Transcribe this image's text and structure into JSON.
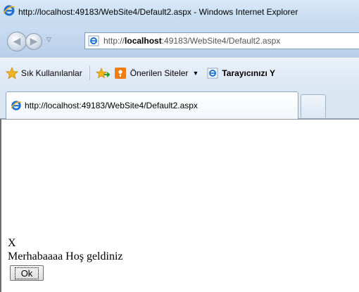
{
  "window": {
    "title": "http://localhost:49183/WebSite4/Default2.aspx - Windows Internet Explorer"
  },
  "navigation": {
    "address_prefix": "http://",
    "address_host": "localhost",
    "address_rest": ":49183/WebSite4/Default2.aspx"
  },
  "favorites_bar": {
    "favorites_label": "Sık Kullanılanlar",
    "suggested_sites_label": "Önerilen Siteler",
    "browser_label": "Tarayıcınızı Y"
  },
  "tabs": [
    {
      "label": "http://localhost:49183/WebSite4/Default2.aspx"
    }
  ],
  "page": {
    "close_text": "X",
    "welcome_text": "Merhabaaaa Hoş geldiniz",
    "ok_label": "Ok"
  },
  "colors": {
    "ie_blue": "#1e6fd0",
    "favorites_star": "#f2b31b",
    "suggested_sites_orange": "#f07d14"
  }
}
